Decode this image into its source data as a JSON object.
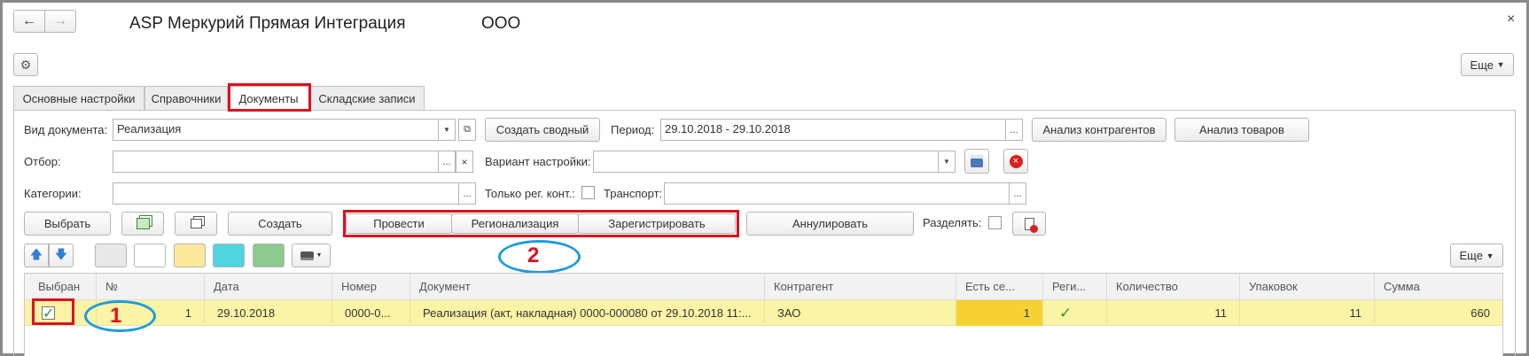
{
  "title": {
    "app_name": "ASP Меркурий Прямая Интеграция",
    "org": "ООО"
  },
  "toolbar": {
    "more_label": "Еще",
    "more_label_2": "Еще"
  },
  "tabs": [
    {
      "label": "Основные настройки"
    },
    {
      "label": "Справочники"
    },
    {
      "label": "Документы"
    },
    {
      "label": "Складские записи"
    }
  ],
  "form": {
    "doc_type_label": "Вид документа:",
    "doc_type_value": "Реализация",
    "create_summary_label": "Создать сводный",
    "period_label": "Период:",
    "period_value": "29.10.2018 - 29.10.2018",
    "analyze_counterparties_label": "Анализ контрагентов",
    "analyze_goods_label": "Анализ товаров",
    "filter_label": "Отбор:",
    "filter_value": "",
    "variant_label": "Вариант настройки:",
    "variant_value": "",
    "categories_label": "Категории:",
    "categories_value": "",
    "only_reg_label": "Только рег. конт.:",
    "transport_label": "Транспорт:",
    "transport_value": ""
  },
  "actions": {
    "select_label": "Выбрать",
    "create_label": "Создать",
    "post_label": "Провести",
    "regionalize_label": "Регионализация",
    "register_label": "Зарегистрировать",
    "cancel_label": "Аннулировать",
    "split_label": "Разделять:"
  },
  "annotations": {
    "mark1": "1",
    "mark2": "2"
  },
  "colors": {
    "selected_row": "#fbf3a6",
    "swatch_gray": "#e8e8e8",
    "swatch_white": "#ffffff",
    "swatch_yellow": "#fbe89a",
    "swatch_cyan": "#4fd4e0",
    "swatch_green": "#8dc98d",
    "highlight_cell": "#f5d232",
    "annotation_red": "#e0101d",
    "annotation_blue": "#1e9be0"
  },
  "table": {
    "columns": [
      "Выбран",
      "№",
      "Дата",
      "Номер",
      "Документ",
      "Контрагент",
      "Есть се...",
      "Реги...",
      "Количество",
      "Упаковок",
      "Сумма"
    ],
    "rows": [
      {
        "selected": true,
        "num": "1",
        "date": "29.10.2018",
        "number": "0000-0...",
        "document": "Реализация (акт, накладная) 0000-000080 от 29.10.2018 11:...",
        "counterparty": "ЗАО",
        "has_series": "1",
        "registered": true,
        "quantity": "11",
        "packages": "11",
        "sum": "660"
      }
    ]
  }
}
